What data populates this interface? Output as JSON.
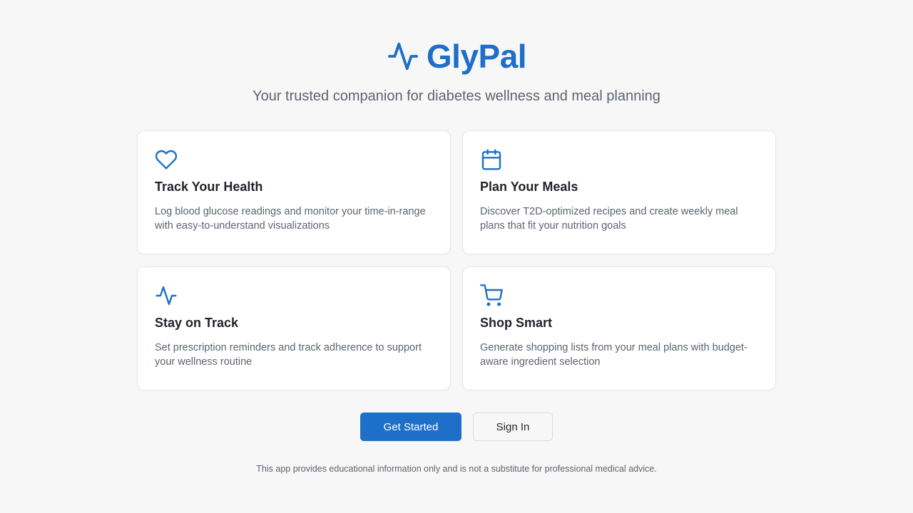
{
  "brand": {
    "name": "GlyPal",
    "icon": "activity-pulse-icon",
    "color": "#1e6fc8"
  },
  "tagline": "Your trusted companion for diabetes wellness and meal planning",
  "features": [
    {
      "icon": "heart-icon",
      "title": "Track Your Health",
      "description": "Log blood glucose readings and monitor your time-in-range with easy-to-understand visualizations"
    },
    {
      "icon": "calendar-icon",
      "title": "Plan Your Meals",
      "description": "Discover T2D-optimized recipes and create weekly meal plans that fit your nutrition goals"
    },
    {
      "icon": "activity-icon",
      "title": "Stay on Track",
      "description": "Set prescription reminders and track adherence to support your wellness routine"
    },
    {
      "icon": "shopping-cart-icon",
      "title": "Shop Smart",
      "description": "Generate shopping lists from your meal plans with budget-aware ingredient selection"
    }
  ],
  "actions": {
    "get_started_label": "Get Started",
    "sign_in_label": "Sign In"
  },
  "disclaimer": "This app provides educational information only and is not a substitute for professional medical advice.",
  "colors": {
    "accent": "#1e6fc8",
    "background": "#f7f7f7",
    "muted_text": "#5c6470"
  }
}
